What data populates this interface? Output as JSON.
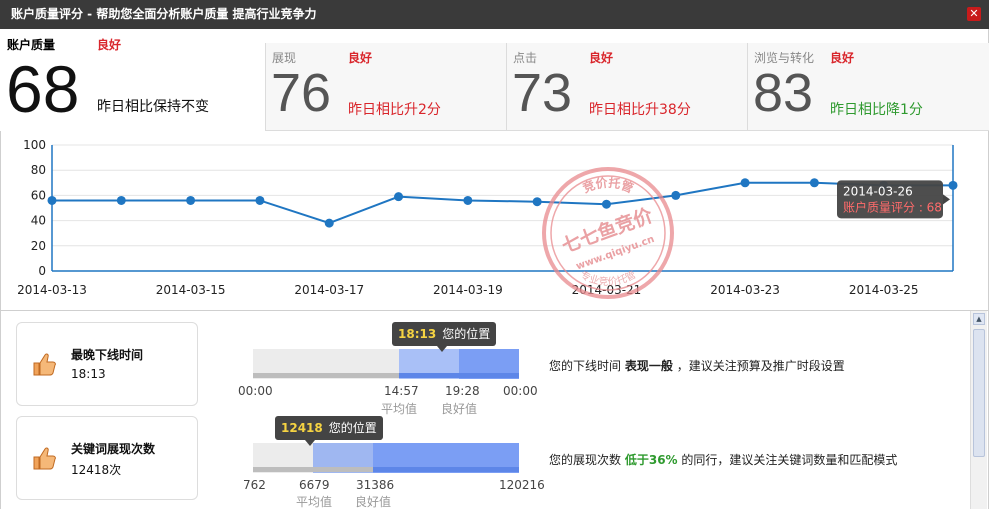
{
  "window": {
    "title": "账户质量评分 - 帮助您全面分析账户质量 提高行业竞争力",
    "close_icon": "close-icon",
    "close_color": "#c81b1b"
  },
  "scores": {
    "main": {
      "label": "账户质量",
      "rating": "良好",
      "value": "68",
      "compare": "昨日相比保持不变"
    },
    "items": [
      {
        "label": "展现",
        "rating": "良好",
        "value": "76",
        "compare": "昨日相比升2分",
        "trend": "up"
      },
      {
        "label": "点击",
        "rating": "良好",
        "value": "73",
        "compare": "昨日相比升38分",
        "trend": "up"
      },
      {
        "label": "浏览与转化",
        "rating": "良好",
        "value": "83",
        "compare": "昨日相比降1分",
        "trend": "down"
      }
    ]
  },
  "chart_data": {
    "type": "line",
    "x": [
      "2014-03-13",
      "2014-03-14",
      "2014-03-15",
      "2014-03-16",
      "2014-03-17",
      "2014-03-18",
      "2014-03-19",
      "2014-03-20",
      "2014-03-21",
      "2014-03-22",
      "2014-03-23",
      "2014-03-24",
      "2014-03-25",
      "2014-03-26"
    ],
    "x_tick_labels": [
      "2014-03-13",
      "2014-03-15",
      "2014-03-17",
      "2014-03-19",
      "2014-03-21",
      "2014-03-23",
      "2014-03-25"
    ],
    "series": [
      {
        "values": [
          56,
          56,
          56,
          56,
          38,
          59,
          56,
          55,
          53,
          60,
          70,
          70,
          68,
          68
        ]
      }
    ],
    "ylim": [
      0,
      100
    ],
    "y_ticks": [
      "0",
      "20",
      "40",
      "60",
      "80",
      "100"
    ],
    "grid": true,
    "line_color": "#1f76c2",
    "tooltip": {
      "date": "2014-03-26",
      "text": "账户质量评分 : 68"
    }
  },
  "watermark": {
    "main": "七七鱼竞价",
    "top": "竞价托管",
    "url": "www.qiqiyu.cn",
    "bottom": "专业竞价托管"
  },
  "metrics": [
    {
      "title": "最晚下线时间",
      "value": "18:13",
      "icon": "thumbs-up-icon",
      "bubble_value": "18:13",
      "bubble_label": "您的位置",
      "ticks": [
        "00:00",
        "14:57",
        "19:28",
        "00:00"
      ],
      "caption_avg": "平均值",
      "caption_good": "良好值",
      "advice_prefix": "您的下线时间",
      "advice_em": "表现一般",
      "advice_suffix": "，建议关注预算及推广时段设置"
    },
    {
      "title": "关键词展现次数",
      "value": "12418次",
      "icon": "thumbs-up-icon",
      "bubble_value": "12418",
      "bubble_label": "您的位置",
      "ticks": [
        "762",
        "6679",
        "31386",
        "120216"
      ],
      "caption_avg": "平均值",
      "caption_good": "良好值",
      "advice_prefix": "您的展现次数",
      "advice_em": "低于36%",
      "advice_suffix": "的同行，建议关注关键词数量和匹配模式"
    }
  ],
  "scroll_icon": "scroll-up-icon"
}
